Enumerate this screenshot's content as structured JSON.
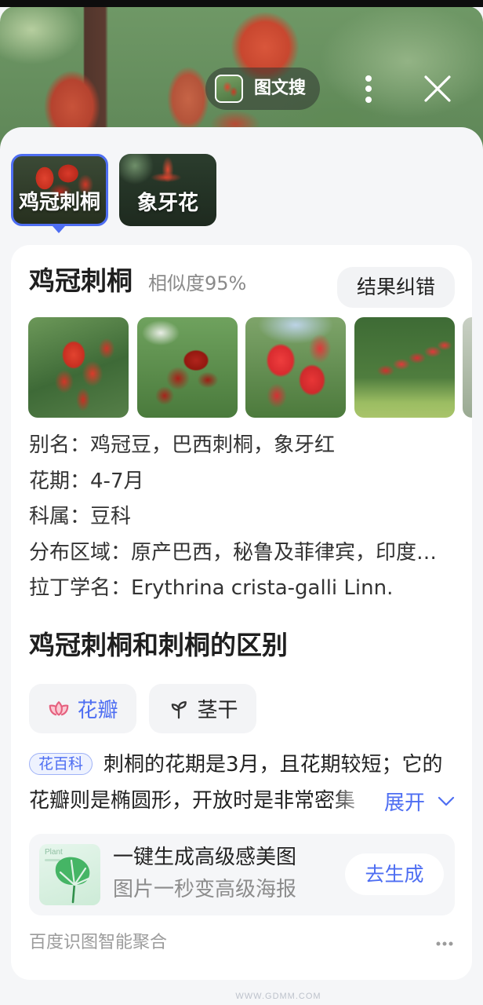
{
  "colors": {
    "accent": "#4e6ef2",
    "title_text": "#1f1f1f",
    "muted_text": "#8a8a8a",
    "flower_icon": "#e5607e",
    "sheet_background": "#f5f6f8",
    "card_background": "#ffffff"
  },
  "header": {
    "search_mode": {
      "label": "图文搜",
      "thumbnail_icon": "query-image-thumbnail"
    },
    "more_icon": "more-vertical-icon",
    "close_icon": "close-icon"
  },
  "candidates": {
    "items": [
      {
        "label": "鸡冠刺桐",
        "selected": true
      },
      {
        "label": "象牙花",
        "selected": false
      }
    ]
  },
  "result": {
    "name": "鸡冠刺桐",
    "similarity": "相似度95%",
    "feedback_button": "结果纠错",
    "info": [
      {
        "label": "别名：",
        "value": "鸡冠豆，巴西刺桐，象牙红"
      },
      {
        "label": "花期：",
        "value": "4-7月"
      },
      {
        "label": "科属：",
        "value": "豆科"
      },
      {
        "label": "分布区域：",
        "value": "原产巴西，秘鲁及菲律宾，印度…"
      },
      {
        "label": "拉丁学名：",
        "value": "Erythrina crista-galli Linn."
      }
    ]
  },
  "comparison": {
    "title": "鸡冠刺桐和刺桐的区别",
    "tabs": [
      {
        "label": "花瓣",
        "icon": "flower-icon",
        "active": true
      },
      {
        "label": "茎干",
        "icon": "sprout-icon",
        "active": false
      }
    ],
    "source_badge": "花百科",
    "text": "刺桐的花期是3月，且花期较短；它的花瓣则是椭圆形，开放时是非常密集",
    "expand_label": "展开",
    "expand_icon": "chevron-down-icon"
  },
  "promo": {
    "icon_caption": "Plant",
    "title": "一键生成高级感美图",
    "subtitle": "图片一秒变高级海报",
    "button_label": "去生成"
  },
  "footer": {
    "source": "百度识图智能聚合",
    "more_icon": "more-horizontal-icon"
  },
  "watermark": "WWW.GDMM.COM"
}
